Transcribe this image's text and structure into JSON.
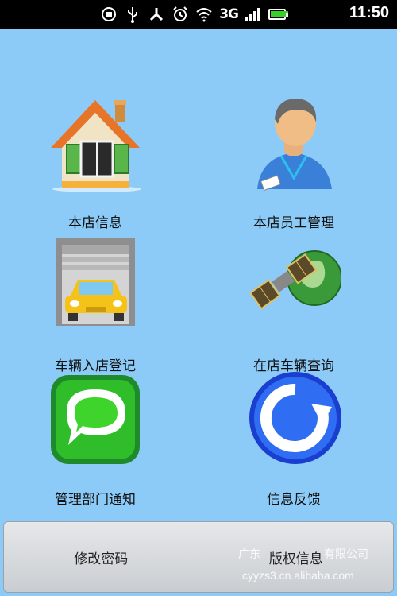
{
  "status_bar": {
    "time": "11:50",
    "network": "3G",
    "icons": [
      "message-icon",
      "usb-icon",
      "share-icon",
      "alarm-icon",
      "wifi-icon",
      "signal-icon",
      "battery-icon"
    ]
  },
  "grid": {
    "items": [
      {
        "label": "本店信息",
        "icon": "house-icon"
      },
      {
        "label": "本店员工管理",
        "icon": "employee-icon"
      },
      {
        "label": "车辆入店登记",
        "icon": "car-garage-icon"
      },
      {
        "label": "在店车辆查询",
        "icon": "satellite-globe-icon"
      },
      {
        "label": "管理部门通知",
        "icon": "chat-bubble-icon"
      },
      {
        "label": "信息反馈",
        "icon": "refresh-icon"
      }
    ]
  },
  "bottom_menu": {
    "change_password": "修改密码",
    "copyright": "版权信息"
  },
  "watermark": {
    "company": "广东",
    "company_suffix": "有限公司",
    "site": "cyyzs3.cn.alibaba.com"
  },
  "colors": {
    "background": "#8ccbf7",
    "status_bar": "#000000",
    "battery": "#3ad02a"
  }
}
